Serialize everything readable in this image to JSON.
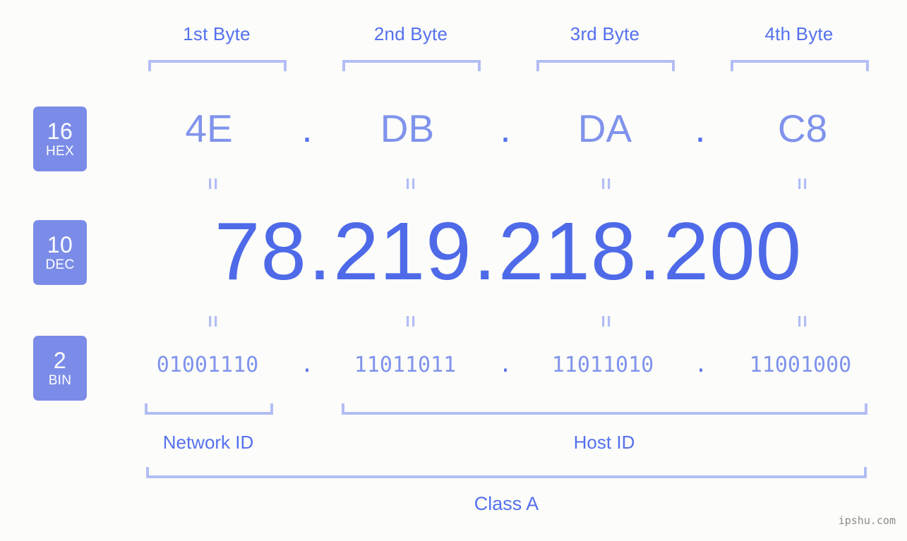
{
  "background_color": "#fcfdfa",
  "accent_color": "#5570ee",
  "light_accent_color": "#8093ec",
  "bracket_color": "#b3bdf5",
  "badge_color": "#7b8ce8",
  "byte_headers": [
    {
      "label": "1st Byte"
    },
    {
      "label": "2nd Byte"
    },
    {
      "label": "3rd Byte"
    },
    {
      "label": "4th Byte"
    }
  ],
  "rows": {
    "hex": {
      "badge_number": "16",
      "badge_name": "HEX",
      "values": [
        "4E",
        "DB",
        "DA",
        "C8"
      ],
      "separator": "."
    },
    "dec": {
      "badge_number": "10",
      "badge_name": "DEC",
      "values": [
        "78",
        "219",
        "218",
        "200"
      ],
      "separator": ".",
      "full": "78.219.218.200"
    },
    "bin": {
      "badge_number": "2",
      "badge_name": "BIN",
      "values": [
        "01001110",
        "11011011",
        "11011010",
        "11001000"
      ],
      "separator": ".",
      "full": "01001110.11011011.11011010.11001000"
    }
  },
  "equal_mark": "=",
  "regions": [
    {
      "label": "Network ID"
    },
    {
      "label": "Host ID"
    }
  ],
  "class": {
    "label": "Class A"
  },
  "watermark": "ipshu.com"
}
